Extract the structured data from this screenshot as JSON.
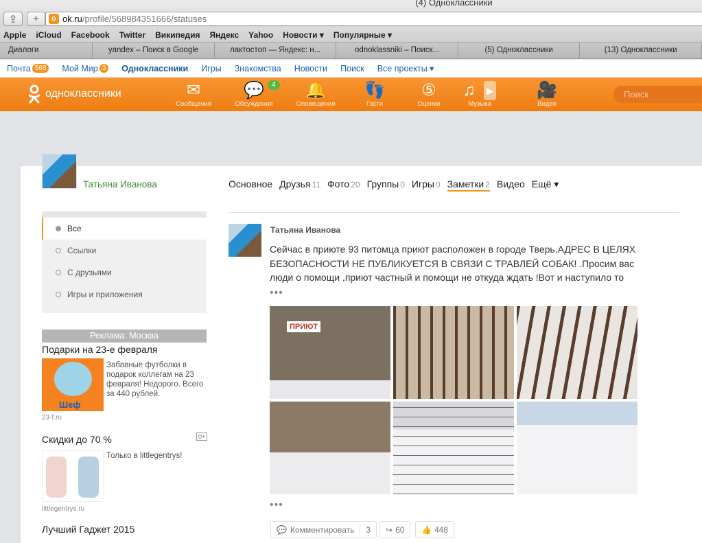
{
  "browser": {
    "window_title": "(4) Одноклассники",
    "url_host": "ok.ru",
    "url_path": "/profile/568984351666/statuses",
    "bookmarks": [
      "Apple",
      "iCloud",
      "Facebook",
      "Twitter",
      "Википедия",
      "Яндекс",
      "Yahoo",
      "Новости ▾",
      "Популярные ▾"
    ],
    "tabs": [
      "Диалоги",
      "yandex – Поиск в Google",
      "лактостоп — Яндекс: н...",
      "odnoklassniki – Поиск...",
      "(5) Одноклассники",
      "(13) Одноклассники"
    ]
  },
  "portal": {
    "items": [
      {
        "label": "Почта",
        "count": "568"
      },
      {
        "label": "Мой Мир",
        "count": "3"
      },
      {
        "label": "Одноклассники"
      },
      {
        "label": "Игры"
      },
      {
        "label": "Знакомства"
      },
      {
        "label": "Новости"
      },
      {
        "label": "Поиск"
      },
      {
        "label": "Все проекты ▾"
      }
    ]
  },
  "header": {
    "logo_text": "одноклассники",
    "nav": [
      {
        "label": "Сообщения",
        "icon": "envelope-icon"
      },
      {
        "label": "Обсуждения",
        "icon": "chat-bubbles-icon",
        "badge": "4"
      },
      {
        "label": "Оповещения",
        "icon": "bell-icon"
      },
      {
        "label": "Гости",
        "icon": "footprints-icon"
      },
      {
        "label": "Оценки",
        "icon": "rating-icon"
      },
      {
        "label": "Музыка",
        "icon": "music-note-icon"
      },
      {
        "label": "Видео",
        "icon": "video-camera-icon"
      }
    ],
    "search_placeholder": "Поиск",
    "accent": "#f7931e"
  },
  "profile": {
    "name": "Татьяна Иванова",
    "tabs": [
      {
        "label": "Основное",
        "count": ""
      },
      {
        "label": "Друзья",
        "count": "11"
      },
      {
        "label": "Фото",
        "count": "20"
      },
      {
        "label": "Группы",
        "count": "0"
      },
      {
        "label": "Игры",
        "count": "0"
      },
      {
        "label": "Заметки",
        "count": "2",
        "active": true
      },
      {
        "label": "Видео",
        "count": ""
      },
      {
        "label": "Ещё ▾",
        "count": ""
      }
    ]
  },
  "sidemenu": [
    "Все",
    "Ссылки",
    "С друзьями",
    "Игры и приложения"
  ],
  "ads": {
    "header": "Реклама: Москва",
    "items": [
      {
        "title": "Подарки на 23-е февраля",
        "text": "Забавные футболки в подарок коллегам на 23 февраля! Недорого. Всего за 440 рублей.",
        "source": "23-f.ru",
        "img_text": "Шеф"
      },
      {
        "title": "Скидки до 70 %",
        "age": "0+",
        "text": "Только в littlegentrys!",
        "source": "littlegentrys.ru"
      },
      {
        "title": "Лучший Гаджет 2015"
      }
    ]
  },
  "post": {
    "author": "Татьяна Иванова",
    "text": "Сейчас  в приюте 93 питомца  приют расположен в городе Тверь.АДРЕС В ЦЕЛЯХ БЕЗОПАСНОСТИ НЕ ПУБЛИКУЕТСЯ В СВЯЗИ С ТРАВЛЕЙ СОБАК! .Просим вас люди о помощи ,приют частный и помощи не откуда ждать !Вот и наступило то",
    "more": "•••",
    "photo_sign": "ПРИЮТ",
    "comment_label": "Комментировать",
    "comment_count": "3",
    "share_count": "60",
    "like_count": "448"
  }
}
